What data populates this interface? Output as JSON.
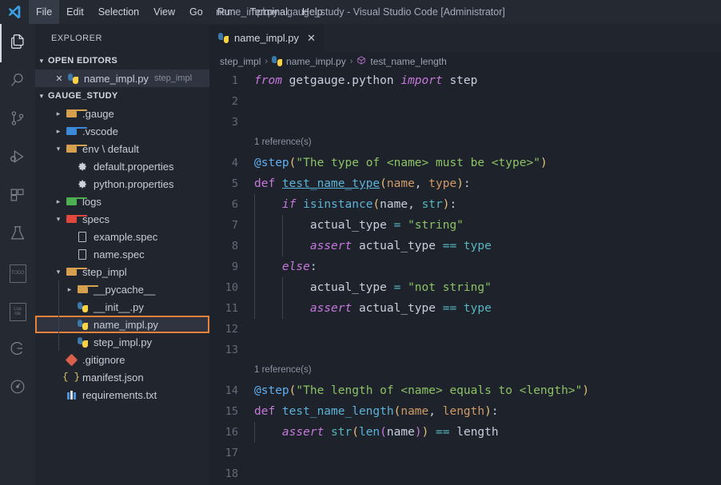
{
  "window": {
    "title": "name_impl.py - gauge_study - Visual Studio Code [Administrator]",
    "logo_icon": "vscode-logo-icon"
  },
  "menu": {
    "items": [
      {
        "label": "File",
        "active": true
      },
      {
        "label": "Edit",
        "active": false
      },
      {
        "label": "Selection",
        "active": false
      },
      {
        "label": "View",
        "active": false
      },
      {
        "label": "Go",
        "active": false
      },
      {
        "label": "Run",
        "active": false
      },
      {
        "label": "Terminal",
        "active": false
      },
      {
        "label": "Help",
        "active": false
      }
    ]
  },
  "activity_bar": {
    "items": [
      {
        "name": "explorer-icon",
        "active": true
      },
      {
        "name": "search-icon",
        "active": false
      },
      {
        "name": "source-control-icon",
        "active": false
      },
      {
        "name": "run-and-debug-icon",
        "active": false
      },
      {
        "name": "extensions-icon",
        "active": false
      },
      {
        "name": "testing-flask-icon",
        "active": false
      },
      {
        "name": "todo-tree-icon",
        "active": false,
        "text": "TODO"
      },
      {
        "name": "lua-ide-icon",
        "active": false,
        "text": "Lua\nIde"
      },
      {
        "name": "gauge-icon",
        "active": false
      },
      {
        "name": "timeline-clock-icon",
        "active": false
      }
    ]
  },
  "sidebar": {
    "title": "EXPLORER",
    "open_editors": {
      "label": "OPEN EDITORS",
      "expanded": true,
      "items": [
        {
          "name": "name_impl.py",
          "sub": "step_impl",
          "icon": "python-icon",
          "selected": true
        }
      ]
    },
    "workspace": {
      "label": "GAUGE_STUDY",
      "expanded": true,
      "tree": [
        {
          "label": ".gauge",
          "icon": "folder-icon",
          "depth": 1,
          "twisty": "collapsed",
          "color": "#d6a04f"
        },
        {
          "label": ".vscode",
          "icon": "vscode-folder-icon",
          "depth": 1,
          "twisty": "collapsed",
          "color": "#3b8ad9"
        },
        {
          "label": "env \\ default",
          "icon": "folder-icon",
          "depth": 1,
          "twisty": "expanded",
          "color": "#d6a04f"
        },
        {
          "label": "default.properties",
          "icon": "gear-icon",
          "depth": 2,
          "twisty": "none"
        },
        {
          "label": "python.properties",
          "icon": "gear-icon",
          "depth": 2,
          "twisty": "none"
        },
        {
          "label": "logs",
          "icon": "logs-folder-icon",
          "depth": 1,
          "twisty": "collapsed",
          "color": "#4caf50"
        },
        {
          "label": "specs",
          "icon": "specs-folder-icon",
          "depth": 1,
          "twisty": "expanded",
          "color": "#e0483c"
        },
        {
          "label": "example.spec",
          "icon": "file-icon",
          "depth": 2,
          "twisty": "none"
        },
        {
          "label": "name.spec",
          "icon": "file-icon",
          "depth": 2,
          "twisty": "none"
        },
        {
          "label": "step_impl",
          "icon": "folder-icon",
          "depth": 1,
          "twisty": "expanded",
          "color": "#d6a04f"
        },
        {
          "label": "__pycache__",
          "icon": "folder-icon",
          "depth": 2,
          "twisty": "collapsed",
          "color": "#d6a04f"
        },
        {
          "label": "__init__.py",
          "icon": "python-icon",
          "depth": 2,
          "twisty": "none"
        },
        {
          "label": "name_impl.py",
          "icon": "python-icon",
          "depth": 2,
          "twisty": "none",
          "selected": true,
          "focused": true
        },
        {
          "label": "step_impl.py",
          "icon": "python-icon",
          "depth": 2,
          "twisty": "none"
        },
        {
          "label": ".gitignore",
          "icon": "git-icon",
          "depth": 1,
          "twisty": "none"
        },
        {
          "label": "manifest.json",
          "icon": "json-icon",
          "depth": 1,
          "twisty": "none"
        },
        {
          "label": "requirements.txt",
          "icon": "requirements-icon",
          "depth": 1,
          "twisty": "none"
        }
      ]
    }
  },
  "editor": {
    "tabs": [
      {
        "label": "name_impl.py",
        "icon": "python-icon",
        "active": true,
        "close_icon": "close-icon"
      }
    ],
    "breadcrumb": [
      {
        "label": "step_impl",
        "icon": null
      },
      {
        "label": "name_impl.py",
        "icon": "python-icon"
      },
      {
        "label": "test_name_length",
        "icon": "method-cube-icon"
      }
    ],
    "breadcrumb_separator": "›",
    "codelens": {
      "first": "1 reference(s)",
      "second": "1 reference(s)"
    },
    "lines": [
      {
        "n": "1",
        "tokens": [
          {
            "t": "from ",
            "c": "t-kw"
          },
          {
            "t": "getgauge.python ",
            "c": "t-plain"
          },
          {
            "t": "import ",
            "c": "t-kw"
          },
          {
            "t": "step",
            "c": "t-plain"
          }
        ]
      },
      {
        "n": "2",
        "tokens": []
      },
      {
        "n": "3",
        "tokens": []
      },
      {
        "n": "4",
        "tokens": [
          {
            "t": "@step",
            "c": "t-dec"
          },
          {
            "t": "(",
            "c": "t-par1"
          },
          {
            "t": "\"The type of <name> must be <type>\"",
            "c": "t-str"
          },
          {
            "t": ")",
            "c": "t-par1"
          }
        ]
      },
      {
        "n": "5",
        "tokens": [
          {
            "t": "def ",
            "c": "t-def"
          },
          {
            "t": "test_name_type",
            "c": "t-fn-u"
          },
          {
            "t": "(",
            "c": "t-par1"
          },
          {
            "t": "name",
            "c": "t-param"
          },
          {
            "t": ", ",
            "c": "t-plain"
          },
          {
            "t": "type",
            "c": "t-param"
          },
          {
            "t": ")",
            "c": "t-par1"
          },
          {
            "t": ":",
            "c": "t-plain"
          }
        ]
      },
      {
        "n": "6",
        "indent": 1,
        "tokens": [
          {
            "t": "    ",
            "c": "t-plain"
          },
          {
            "t": "if ",
            "c": "t-kw"
          },
          {
            "t": "isinstance",
            "c": "t-fn"
          },
          {
            "t": "(",
            "c": "t-par1"
          },
          {
            "t": "name",
            "c": "t-plain"
          },
          {
            "t": ", ",
            "c": "t-plain"
          },
          {
            "t": "str",
            "c": "t-op"
          },
          {
            "t": ")",
            "c": "t-par1"
          },
          {
            "t": ":",
            "c": "t-plain"
          }
        ]
      },
      {
        "n": "7",
        "indent": 2,
        "tokens": [
          {
            "t": "        actual_type ",
            "c": "t-plain"
          },
          {
            "t": "=",
            "c": "t-op"
          },
          {
            "t": " ",
            "c": "t-plain"
          },
          {
            "t": "\"string\"",
            "c": "t-str"
          }
        ]
      },
      {
        "n": "8",
        "indent": 2,
        "tokens": [
          {
            "t": "        ",
            "c": "t-plain"
          },
          {
            "t": "assert ",
            "c": "t-kw"
          },
          {
            "t": "actual_type ",
            "c": "t-plain"
          },
          {
            "t": "==",
            "c": "t-op"
          },
          {
            "t": " ",
            "c": "t-plain"
          },
          {
            "t": "type",
            "c": "t-op"
          }
        ]
      },
      {
        "n": "9",
        "indent": 1,
        "tokens": [
          {
            "t": "    ",
            "c": "t-plain"
          },
          {
            "t": "else",
            "c": "t-kw"
          },
          {
            "t": ":",
            "c": "t-plain"
          }
        ]
      },
      {
        "n": "10",
        "indent": 2,
        "tokens": [
          {
            "t": "        actual_type ",
            "c": "t-plain"
          },
          {
            "t": "=",
            "c": "t-op"
          },
          {
            "t": " ",
            "c": "t-plain"
          },
          {
            "t": "\"not string\"",
            "c": "t-str"
          }
        ]
      },
      {
        "n": "11",
        "indent": 2,
        "tokens": [
          {
            "t": "        ",
            "c": "t-plain"
          },
          {
            "t": "assert ",
            "c": "t-kw"
          },
          {
            "t": "actual_type ",
            "c": "t-plain"
          },
          {
            "t": "==",
            "c": "t-op"
          },
          {
            "t": " ",
            "c": "t-plain"
          },
          {
            "t": "type",
            "c": "t-op"
          }
        ]
      },
      {
        "n": "12",
        "tokens": []
      },
      {
        "n": "13",
        "tokens": []
      },
      {
        "n": "14",
        "tokens": [
          {
            "t": "@step",
            "c": "t-dec"
          },
          {
            "t": "(",
            "c": "t-par1"
          },
          {
            "t": "\"The length of <name> equals to <length>\"",
            "c": "t-str"
          },
          {
            "t": ")",
            "c": "t-par1"
          }
        ]
      },
      {
        "n": "15",
        "tokens": [
          {
            "t": "def ",
            "c": "t-def"
          },
          {
            "t": "test_name_length",
            "c": "t-fn"
          },
          {
            "t": "(",
            "c": "t-par1"
          },
          {
            "t": "name",
            "c": "t-param"
          },
          {
            "t": ", ",
            "c": "t-plain"
          },
          {
            "t": "length",
            "c": "t-param"
          },
          {
            "t": ")",
            "c": "t-par1"
          },
          {
            "t": ":",
            "c": "t-plain"
          }
        ]
      },
      {
        "n": "16",
        "indent": 1,
        "tokens": [
          {
            "t": "    ",
            "c": "t-plain"
          },
          {
            "t": "assert ",
            "c": "t-kw"
          },
          {
            "t": "str",
            "c": "t-op"
          },
          {
            "t": "(",
            "c": "t-par1"
          },
          {
            "t": "len",
            "c": "t-fn"
          },
          {
            "t": "(",
            "c": "t-par2"
          },
          {
            "t": "name",
            "c": "t-plain"
          },
          {
            "t": ")",
            "c": "t-par2"
          },
          {
            "t": ")",
            "c": "t-par1"
          },
          {
            "t": " ",
            "c": "t-plain"
          },
          {
            "t": "==",
            "c": "t-op"
          },
          {
            "t": " length",
            "c": "t-plain"
          }
        ]
      },
      {
        "n": "17",
        "tokens": []
      },
      {
        "n": "18",
        "tokens": []
      }
    ]
  },
  "colors": {
    "titlebar_bg": "#252932",
    "sidebar_bg": "#21252e",
    "editor_bg": "#1e222a",
    "selection_bg": "#2f3440",
    "focus_border": "#e8813a",
    "string": "#8cc265",
    "keyword": "#c678dd",
    "function": "#5cb3d9",
    "operator": "#56b6c2",
    "param": "#d19a66"
  }
}
